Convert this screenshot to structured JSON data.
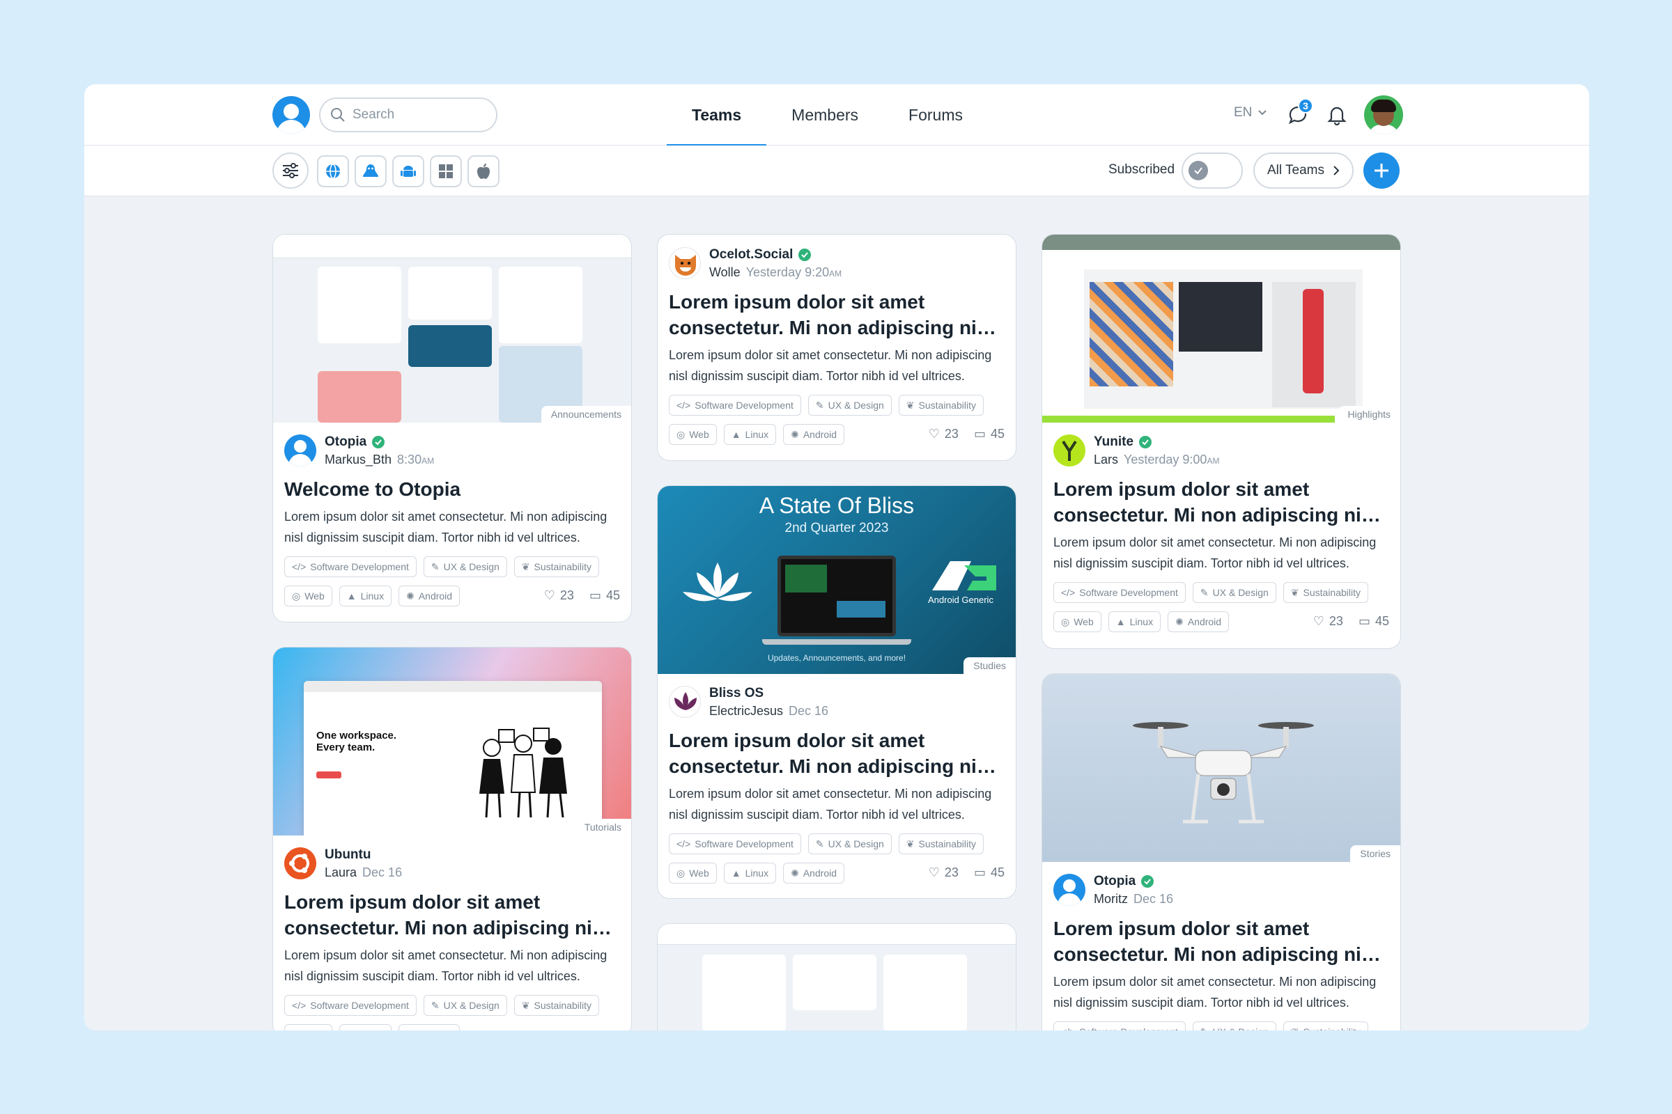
{
  "header": {
    "search_placeholder": "Search",
    "tabs": [
      {
        "label": "Teams"
      },
      {
        "label": "Members"
      },
      {
        "label": "Forums"
      }
    ],
    "language": "EN",
    "chat_badge": "3"
  },
  "filterbar": {
    "subscribed_label": "Subscribed",
    "all_teams_label": "All Teams"
  },
  "colors": {
    "accent": "#1e8fe6",
    "verified": "#2fb37a"
  },
  "platforms": [
    "filter-icon",
    "globe-icon",
    "linux-icon",
    "android-icon",
    "windows-icon",
    "apple-icon"
  ],
  "common": {
    "title": "Lorem ipsum dolor sit amet consectetur. Mi non adipiscing nisl dignissim",
    "description": "Lorem ipsum dolor sit amet consectetur. Mi non adipiscing nisl dignissim suscipit diam. Tortor nibh id vel ultrices.",
    "topic_tags": [
      "Software Development",
      "UX & Design",
      "Sustainability"
    ],
    "platform_tags": [
      "Web",
      "Linux",
      "Android"
    ],
    "likes": "23",
    "comments": "45"
  },
  "cards": [
    {
      "org": "Otopia",
      "author": "Markus_Bth",
      "time": "8:30",
      "ampm": "AM",
      "title": "Welcome to Otopia",
      "image_tag": "Announcements"
    },
    {
      "org": "Ubuntu",
      "author": "Laura",
      "time": "Dec 16",
      "ampm": "",
      "image_tag": "Tutorials",
      "image_text": {
        "line1": "One workspace.",
        "line2": "Every team."
      }
    },
    {
      "org": "Ocelot.Social",
      "author": "Wolle",
      "time": "Yesterday 9:20",
      "ampm": "AM"
    },
    {
      "org": "Bliss OS",
      "author": "ElectricJesus",
      "time": "Dec 16",
      "ampm": "",
      "image_tag": "Studies",
      "image_text": {
        "title": "A State Of Bliss",
        "subtitle": "2nd Quarter 2023",
        "brand": "Android Generic",
        "footer": "Updates, Announcements, and more!"
      }
    },
    {
      "org": "Yunite",
      "author": "Lars",
      "time": "Yesterday 9:00",
      "ampm": "AM",
      "image_tag": "Highlights"
    },
    {
      "org": "Otopia",
      "author": "Moritz",
      "time": "Dec 16",
      "ampm": "",
      "image_tag": "Stories"
    }
  ]
}
